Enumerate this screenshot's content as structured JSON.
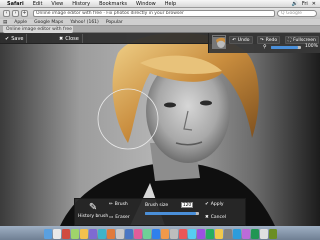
{
  "menubar": {
    "items": [
      "Safari",
      "Edit",
      "View",
      "History",
      "Bookmarks",
      "Window",
      "Help"
    ],
    "status": [
      "🔊",
      "Fri",
      "✕"
    ]
  },
  "browser": {
    "url": "Online image editor with free · Fix photos directly in your browser",
    "search_placeholder": "Q Google",
    "bookmarks": [
      "Apple",
      "Google Maps",
      "Yahoo! (161)",
      "Popular"
    ],
    "tab_title": "Online image editor with free Fix"
  },
  "editor": {
    "toolbar": {
      "save_label": "Save",
      "close_label": "Close"
    },
    "panel": {
      "undo_label": "Undo",
      "redo_label": "Redo",
      "fullscreen_label": "Fullscreen",
      "zoom_value": "100%",
      "zoom_fraction": 0.9
    },
    "bottom": {
      "history_brush_label": "History brush",
      "brush_label": "Brush",
      "eraser_label": "Eraser",
      "brush_size_label": "Brush size",
      "brush_size_value": "120",
      "brush_size_fraction": 0.95,
      "apply_label": "Apply",
      "cancel_label": "Cancel"
    }
  },
  "colors": {
    "accent": "#4a8fd9",
    "panel_bg": "#2d2d2d"
  },
  "dock": {
    "icon_colors": [
      "#5aa0e0",
      "#e9e9e9",
      "#d04b3f",
      "#9fd46b",
      "#f2c14e",
      "#7f6bd1",
      "#3fb3c9",
      "#e07a3a",
      "#c9c9c9",
      "#4a77c4",
      "#e35d9a",
      "#6fcf97",
      "#2f80ed",
      "#f2994a",
      "#bdbdbd",
      "#eb5757",
      "#56ccf2",
      "#9b51e0",
      "#27ae60",
      "#f2c94c",
      "#828282",
      "#2d9cdb",
      "#bb6bd9",
      "#219653",
      "#e0e0e0",
      "#6b8e23"
    ]
  }
}
